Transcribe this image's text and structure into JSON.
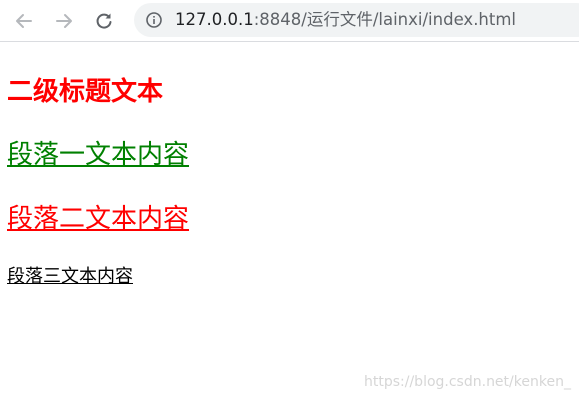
{
  "browser": {
    "url_host": "127.0.0.1",
    "url_path": ":8848/运行文件/lainxi/index.html"
  },
  "page": {
    "heading": "二级标题文本",
    "paragraphs": [
      "段落一文本内容",
      "段落二文本内容",
      "段落三文本内容"
    ]
  },
  "watermark": "https://blog.csdn.net/kenken_",
  "colors": {
    "heading": "#ff0000",
    "paragraph_1": "#008000",
    "paragraph_2": "#ff0000",
    "paragraph_3": "#000000"
  },
  "icons": {
    "back": "arrow-left-icon",
    "forward": "arrow-right-icon",
    "reload": "reload-icon",
    "site_info": "info-icon"
  }
}
